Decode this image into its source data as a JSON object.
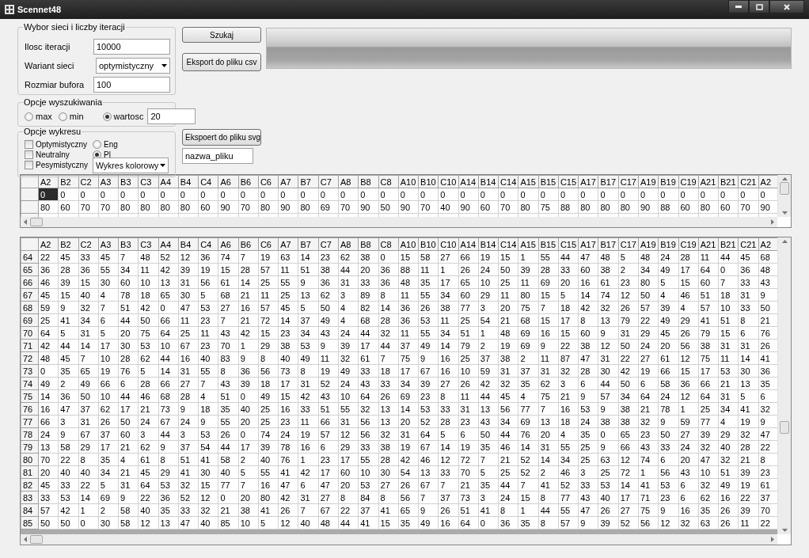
{
  "window": {
    "title": "Scennet48"
  },
  "network_group": {
    "title": "Wybor sieci i liczby iteracji",
    "fields": [
      {
        "kind": "text",
        "label": "Ilosc iteracji",
        "value": "10000"
      },
      {
        "kind": "dropdown",
        "label": "Wariant sieci",
        "value": "optymistyczny"
      },
      {
        "kind": "text",
        "label": "Rozmiar bufora",
        "value": "100"
      }
    ]
  },
  "search_button": "Szukaj",
  "csv_button": "Eksport do pliku csv",
  "search_group": {
    "title": "Opcje wyszukiwania",
    "options": [
      {
        "label": "max",
        "selected": false
      },
      {
        "label": "min",
        "selected": false
      },
      {
        "label": "wartosc",
        "selected": true
      }
    ],
    "value": "20"
  },
  "chart_group": {
    "title": "Opcje wykresu",
    "series": [
      {
        "label": "Optymistyczny",
        "checked": false
      },
      {
        "label": "Neutralny",
        "checked": false
      },
      {
        "label": "Pesymistyczny",
        "checked": false
      }
    ],
    "languages": [
      {
        "label": "Eng",
        "selected": false
      },
      {
        "label": "Pl",
        "selected": true
      }
    ],
    "chart_type": "Wykres kolorowy"
  },
  "svg_button": "Ekspoert do pliku svg",
  "file_name": {
    "value": "nazwa_pliku"
  },
  "top_grid": {
    "columns": [
      "A2",
      "B2",
      "C2",
      "A3",
      "B3",
      "C3",
      "A4",
      "B4",
      "C4",
      "A6",
      "B6",
      "C6",
      "A7",
      "B7",
      "C7",
      "A8",
      "B8",
      "C8",
      "A10",
      "B10",
      "C10",
      "A14",
      "B14",
      "C14",
      "A15",
      "B15",
      "C15",
      "A17",
      "B17",
      "C17",
      "A19",
      "B19",
      "C19",
      "A21",
      "B21",
      "C21",
      "A2"
    ],
    "rows": [
      {
        "cells": [
          {
            "text": "0",
            "selected": true
          },
          {
            "text": "0",
            "selected": false
          },
          {
            "text": "0",
            "selected": false
          },
          {
            "text": "0",
            "selected": false
          },
          {
            "text": "0",
            "selected": false
          },
          {
            "text": "0",
            "selected": false
          },
          {
            "text": "0",
            "selected": false
          },
          {
            "text": "0",
            "selected": false
          },
          {
            "text": "0",
            "selected": false
          },
          {
            "text": "0",
            "selected": false
          },
          {
            "text": "0",
            "selected": false
          },
          {
            "text": "0",
            "selected": false
          },
          {
            "text": "0",
            "selected": false
          },
          {
            "text": "0",
            "selected": false
          },
          {
            "text": "0",
            "selected": false
          },
          {
            "text": "0",
            "selected": false
          },
          {
            "text": "0",
            "selected": false
          },
          {
            "text": "0",
            "selected": false
          },
          {
            "text": "0",
            "selected": false
          },
          {
            "text": "0",
            "selected": false
          },
          {
            "text": "0",
            "selected": false
          },
          {
            "text": "0",
            "selected": false
          },
          {
            "text": "0",
            "selected": false
          },
          {
            "text": "0",
            "selected": false
          },
          {
            "text": "0",
            "selected": false
          },
          {
            "text": "0",
            "selected": false
          },
          {
            "text": "0",
            "selected": false
          },
          {
            "text": "0",
            "selected": false
          },
          {
            "text": "0",
            "selected": false
          },
          {
            "text": "0",
            "selected": false
          },
          {
            "text": "0",
            "selected": false
          },
          {
            "text": "0",
            "selected": false
          },
          {
            "text": "0",
            "selected": false
          },
          {
            "text": "0",
            "selected": false
          },
          {
            "text": "0",
            "selected": false
          },
          {
            "text": "0",
            "selected": false
          },
          {
            "text": "0",
            "selected": false
          }
        ]
      },
      {
        "cells": [
          {
            "text": "80",
            "selected": false
          },
          {
            "text": "60",
            "selected": false
          },
          {
            "text": "70",
            "selected": false
          },
          {
            "text": "70",
            "selected": false
          },
          {
            "text": "80",
            "selected": false
          },
          {
            "text": "80",
            "selected": false
          },
          {
            "text": "80",
            "selected": false
          },
          {
            "text": "80",
            "selected": false
          },
          {
            "text": "60",
            "selected": false
          },
          {
            "text": "90",
            "selected": false
          },
          {
            "text": "70",
            "selected": false
          },
          {
            "text": "80",
            "selected": false
          },
          {
            "text": "90",
            "selected": false
          },
          {
            "text": "80",
            "selected": false
          },
          {
            "text": "69",
            "selected": false
          },
          {
            "text": "70",
            "selected": false
          },
          {
            "text": "90",
            "selected": false
          },
          {
            "text": "50",
            "selected": false
          },
          {
            "text": "90",
            "selected": false
          },
          {
            "text": "70",
            "selected": false
          },
          {
            "text": "40",
            "selected": false
          },
          {
            "text": "90",
            "selected": false
          },
          {
            "text": "60",
            "selected": false
          },
          {
            "text": "70",
            "selected": false
          },
          {
            "text": "80",
            "selected": false
          },
          {
            "text": "75",
            "selected": false
          },
          {
            "text": "88",
            "selected": false
          },
          {
            "text": "80",
            "selected": false
          },
          {
            "text": "80",
            "selected": false
          },
          {
            "text": "80",
            "selected": false
          },
          {
            "text": "90",
            "selected": false
          },
          {
            "text": "88",
            "selected": false
          },
          {
            "text": "60",
            "selected": false
          },
          {
            "text": "80",
            "selected": false
          },
          {
            "text": "60",
            "selected": false
          },
          {
            "text": "70",
            "selected": false
          },
          {
            "text": "90",
            "selected": false
          }
        ]
      }
    ]
  },
  "bottom_grid": {
    "columns": [
      "A2",
      "B2",
      "C2",
      "A3",
      "B3",
      "C3",
      "A4",
      "B4",
      "C4",
      "A6",
      "B6",
      "C6",
      "A7",
      "B7",
      "C7",
      "A8",
      "B8",
      "C8",
      "A10",
      "B10",
      "C10",
      "A14",
      "B14",
      "C14",
      "A15",
      "B15",
      "C15",
      "A17",
      "B17",
      "C17",
      "A19",
      "B19",
      "C19",
      "A21",
      "B21",
      "C21",
      "A2"
    ],
    "rows": [
      {
        "header": "64",
        "cells": [
          "22",
          "45",
          "33",
          "45",
          "7",
          "48",
          "52",
          "12",
          "36",
          "74",
          "7",
          "19",
          "63",
          "14",
          "23",
          "62",
          "38",
          "0",
          "15",
          "58",
          "27",
          "66",
          "19",
          "15",
          "1",
          "55",
          "44",
          "47",
          "48",
          "5",
          "48",
          "24",
          "28",
          "11",
          "44",
          "45",
          "68"
        ]
      },
      {
        "header": "65",
        "cells": [
          "36",
          "28",
          "36",
          "55",
          "34",
          "11",
          "42",
          "39",
          "19",
          "15",
          "28",
          "57",
          "11",
          "51",
          "38",
          "44",
          "20",
          "36",
          "88",
          "11",
          "1",
          "26",
          "24",
          "50",
          "39",
          "28",
          "33",
          "60",
          "38",
          "2",
          "34",
          "49",
          "17",
          "64",
          "0",
          "36",
          "48"
        ]
      },
      {
        "header": "66",
        "cells": [
          "46",
          "39",
          "15",
          "30",
          "60",
          "10",
          "13",
          "31",
          "56",
          "61",
          "14",
          "25",
          "55",
          "9",
          "36",
          "31",
          "33",
          "36",
          "48",
          "35",
          "17",
          "65",
          "10",
          "25",
          "11",
          "69",
          "20",
          "16",
          "61",
          "23",
          "80",
          "5",
          "15",
          "60",
          "7",
          "33",
          "43"
        ]
      },
      {
        "header": "67",
        "cells": [
          "45",
          "15",
          "40",
          "4",
          "78",
          "18",
          "65",
          "30",
          "5",
          "68",
          "21",
          "11",
          "25",
          "13",
          "62",
          "3",
          "89",
          "8",
          "11",
          "55",
          "34",
          "60",
          "29",
          "11",
          "80",
          "15",
          "5",
          "14",
          "74",
          "12",
          "50",
          "4",
          "46",
          "51",
          "18",
          "31",
          "9"
        ]
      },
      {
        "header": "68",
        "cells": [
          "59",
          "9",
          "32",
          "7",
          "51",
          "42",
          "0",
          "47",
          "53",
          "27",
          "16",
          "57",
          "45",
          "5",
          "50",
          "4",
          "82",
          "14",
          "36",
          "26",
          "38",
          "77",
          "3",
          "20",
          "75",
          "7",
          "18",
          "42",
          "32",
          "26",
          "57",
          "39",
          "4",
          "57",
          "10",
          "33",
          "50"
        ]
      },
      {
        "header": "69",
        "cells": [
          "25",
          "41",
          "34",
          "6",
          "44",
          "50",
          "66",
          "11",
          "23",
          "7",
          "21",
          "72",
          "14",
          "37",
          "49",
          "4",
          "68",
          "28",
          "36",
          "53",
          "11",
          "25",
          "54",
          "21",
          "68",
          "15",
          "17",
          "8",
          "13",
          "79",
          "22",
          "49",
          "29",
          "41",
          "51",
          "8",
          "21"
        ]
      },
      {
        "header": "70",
        "cells": [
          "64",
          "5",
          "31",
          "5",
          "20",
          "75",
          "64",
          "25",
          "11",
          "43",
          "42",
          "15",
          "23",
          "34",
          "43",
          "24",
          "44",
          "32",
          "11",
          "55",
          "34",
          "51",
          "1",
          "48",
          "69",
          "16",
          "15",
          "60",
          "9",
          "31",
          "29",
          "45",
          "26",
          "79",
          "15",
          "6",
          "76"
        ]
      },
      {
        "header": "71",
        "cells": [
          "42",
          "44",
          "14",
          "17",
          "30",
          "53",
          "10",
          "67",
          "23",
          "70",
          "1",
          "29",
          "38",
          "53",
          "9",
          "39",
          "17",
          "44",
          "37",
          "49",
          "14",
          "79",
          "2",
          "19",
          "69",
          "9",
          "22",
          "38",
          "12",
          "50",
          "24",
          "20",
          "56",
          "38",
          "31",
          "31",
          "26"
        ]
      },
      {
        "header": "72",
        "cells": [
          "48",
          "45",
          "7",
          "10",
          "28",
          "62",
          "44",
          "16",
          "40",
          "83",
          "9",
          "8",
          "40",
          "49",
          "11",
          "32",
          "61",
          "7",
          "75",
          "9",
          "16",
          "25",
          "37",
          "38",
          "2",
          "11",
          "87",
          "47",
          "31",
          "22",
          "27",
          "61",
          "12",
          "75",
          "11",
          "14",
          "41"
        ]
      },
      {
        "header": "73",
        "cells": [
          "0",
          "35",
          "65",
          "19",
          "76",
          "5",
          "14",
          "31",
          "55",
          "8",
          "36",
          "56",
          "73",
          "8",
          "19",
          "49",
          "33",
          "18",
          "17",
          "67",
          "16",
          "10",
          "59",
          "31",
          "37",
          "31",
          "32",
          "28",
          "30",
          "42",
          "19",
          "66",
          "15",
          "17",
          "53",
          "30",
          "36"
        ]
      },
      {
        "header": "74",
        "cells": [
          "49",
          "2",
          "49",
          "66",
          "6",
          "28",
          "66",
          "27",
          "7",
          "43",
          "39",
          "18",
          "17",
          "31",
          "52",
          "24",
          "43",
          "33",
          "34",
          "39",
          "27",
          "26",
          "42",
          "32",
          "35",
          "62",
          "3",
          "6",
          "44",
          "50",
          "6",
          "58",
          "36",
          "66",
          "21",
          "13",
          "35"
        ]
      },
      {
        "header": "75",
        "cells": [
          "14",
          "36",
          "50",
          "10",
          "44",
          "46",
          "68",
          "28",
          "4",
          "51",
          "0",
          "49",
          "15",
          "42",
          "43",
          "10",
          "64",
          "26",
          "69",
          "23",
          "8",
          "11",
          "44",
          "45",
          "4",
          "75",
          "21",
          "9",
          "57",
          "34",
          "64",
          "24",
          "12",
          "64",
          "31",
          "5",
          "6"
        ]
      },
      {
        "header": "76",
        "cells": [
          "16",
          "47",
          "37",
          "62",
          "17",
          "21",
          "73",
          "9",
          "18",
          "35",
          "40",
          "25",
          "16",
          "33",
          "51",
          "55",
          "32",
          "13",
          "14",
          "53",
          "33",
          "31",
          "13",
          "56",
          "77",
          "7",
          "16",
          "53",
          "9",
          "38",
          "21",
          "78",
          "1",
          "25",
          "34",
          "41",
          "32"
        ]
      },
      {
        "header": "77",
        "cells": [
          "66",
          "3",
          "31",
          "26",
          "50",
          "24",
          "67",
          "24",
          "9",
          "55",
          "20",
          "25",
          "23",
          "11",
          "66",
          "31",
          "56",
          "13",
          "20",
          "52",
          "28",
          "23",
          "43",
          "34",
          "69",
          "13",
          "18",
          "24",
          "38",
          "38",
          "32",
          "9",
          "59",
          "77",
          "4",
          "19",
          "9"
        ]
      },
      {
        "header": "78",
        "cells": [
          "24",
          "9",
          "67",
          "37",
          "60",
          "3",
          "44",
          "3",
          "53",
          "26",
          "0",
          "74",
          "24",
          "19",
          "57",
          "12",
          "56",
          "32",
          "31",
          "64",
          "5",
          "6",
          "50",
          "44",
          "76",
          "20",
          "4",
          "35",
          "0",
          "65",
          "23",
          "50",
          "27",
          "39",
          "29",
          "32",
          "47"
        ]
      },
      {
        "header": "79",
        "cells": [
          "13",
          "58",
          "29",
          "17",
          "21",
          "62",
          "9",
          "37",
          "54",
          "44",
          "17",
          "39",
          "78",
          "16",
          "6",
          "29",
          "33",
          "38",
          "19",
          "67",
          "14",
          "19",
          "35",
          "46",
          "14",
          "31",
          "55",
          "25",
          "9",
          "66",
          "43",
          "33",
          "24",
          "32",
          "40",
          "28",
          "22"
        ]
      },
      {
        "header": "80",
        "cells": [
          "70",
          "22",
          "8",
          "35",
          "4",
          "61",
          "8",
          "51",
          "41",
          "58",
          "2",
          "40",
          "76",
          "1",
          "23",
          "17",
          "55",
          "28",
          "42",
          "46",
          "12",
          "72",
          "7",
          "21",
          "52",
          "14",
          "34",
          "25",
          "63",
          "12",
          "74",
          "6",
          "20",
          "47",
          "32",
          "21",
          "8"
        ]
      },
      {
        "header": "81",
        "cells": [
          "20",
          "40",
          "40",
          "34",
          "21",
          "45",
          "29",
          "41",
          "30",
          "40",
          "5",
          "55",
          "41",
          "42",
          "17",
          "60",
          "10",
          "30",
          "54",
          "13",
          "33",
          "70",
          "5",
          "25",
          "52",
          "2",
          "46",
          "3",
          "25",
          "72",
          "1",
          "56",
          "43",
          "10",
          "51",
          "39",
          "23"
        ]
      },
      {
        "header": "82",
        "cells": [
          "45",
          "33",
          "22",
          "5",
          "31",
          "64",
          "53",
          "32",
          "15",
          "77",
          "7",
          "16",
          "47",
          "6",
          "47",
          "20",
          "53",
          "27",
          "26",
          "67",
          "7",
          "21",
          "35",
          "44",
          "7",
          "41",
          "52",
          "33",
          "53",
          "14",
          "41",
          "53",
          "6",
          "32",
          "49",
          "19",
          "61"
        ]
      },
      {
        "header": "83",
        "cells": [
          "33",
          "53",
          "14",
          "69",
          "9",
          "22",
          "36",
          "52",
          "12",
          "0",
          "20",
          "80",
          "42",
          "31",
          "27",
          "8",
          "84",
          "8",
          "56",
          "7",
          "37",
          "73",
          "3",
          "24",
          "15",
          "8",
          "77",
          "43",
          "40",
          "17",
          "71",
          "23",
          "6",
          "62",
          "16",
          "22",
          "37"
        ]
      },
      {
        "header": "84",
        "cells": [
          "57",
          "42",
          "1",
          "2",
          "58",
          "40",
          "35",
          "33",
          "32",
          "21",
          "38",
          "41",
          "26",
          "7",
          "67",
          "22",
          "37",
          "41",
          "65",
          "9",
          "26",
          "51",
          "41",
          "8",
          "1",
          "44",
          "55",
          "47",
          "26",
          "27",
          "75",
          "9",
          "16",
          "35",
          "26",
          "39",
          "70"
        ]
      },
      {
        "header": "85",
        "cells": [
          "50",
          "50",
          "0",
          "30",
          "58",
          "12",
          "13",
          "47",
          "40",
          "85",
          "10",
          "5",
          "12",
          "40",
          "48",
          "44",
          "41",
          "15",
          "35",
          "49",
          "16",
          "64",
          "0",
          "36",
          "35",
          "8",
          "57",
          "9",
          "39",
          "52",
          "56",
          "12",
          "32",
          "63",
          "26",
          "11",
          "22"
        ]
      }
    ]
  }
}
